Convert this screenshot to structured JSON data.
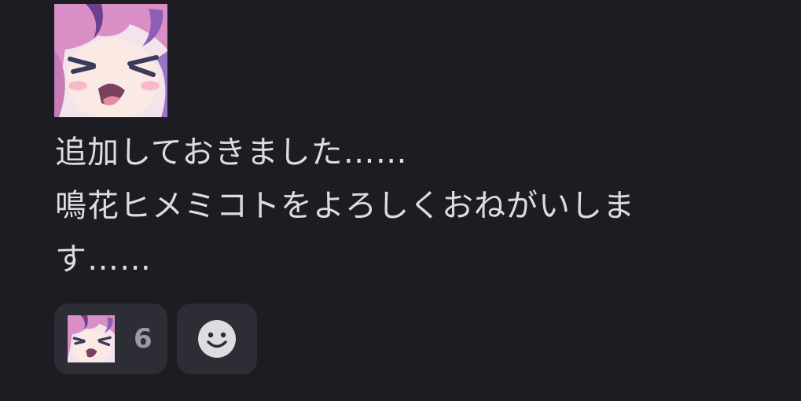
{
  "message": {
    "lines": [
      "追加しておきました……",
      "鳴花ヒメミコトをよろしくおねがいしま",
      "す……"
    ]
  },
  "reactions": [
    {
      "emoji": "sticker-avatar",
      "count": "6"
    }
  ],
  "add_reaction": {
    "icon": "smiley-icon"
  },
  "colors": {
    "background": "#1c1c22",
    "text": "#dcdde1",
    "reaction_bg": "#2d2d35",
    "count_text": "#9a9ba3"
  }
}
